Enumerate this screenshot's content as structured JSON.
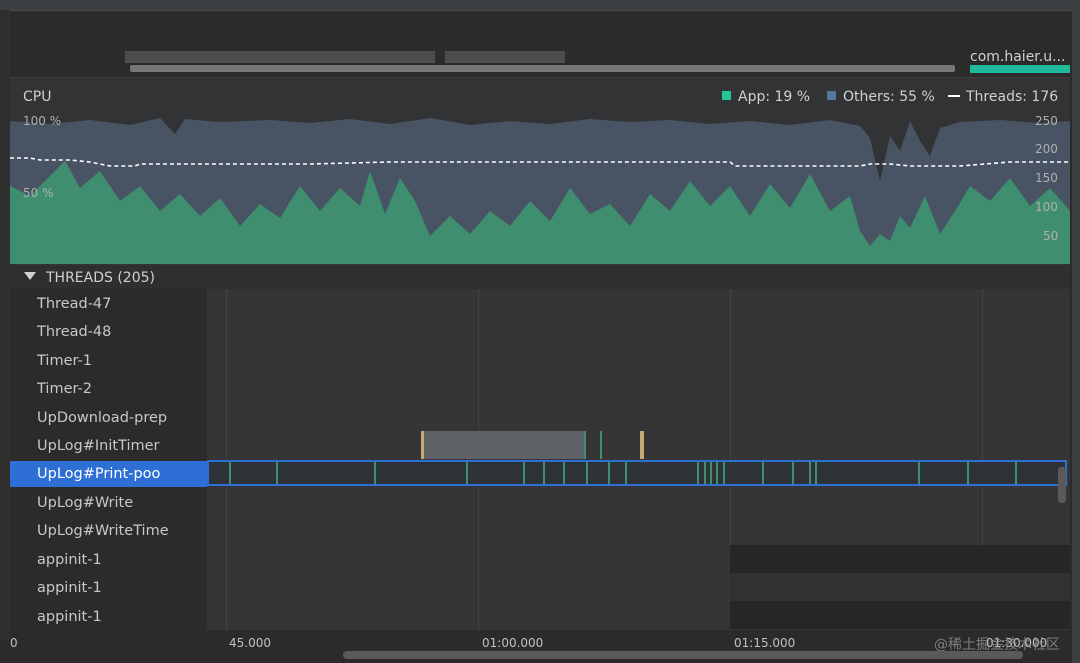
{
  "overview": {
    "process_label": "com.haier.u..."
  },
  "cpu": {
    "label": "CPU",
    "legend": {
      "app": "App: 19 %",
      "others": "Others: 55 %",
      "threads": "Threads: 176"
    },
    "left_axis": [
      "100 %",
      "50 %"
    ],
    "right_axis": [
      "250",
      "200",
      "150",
      "100",
      "50"
    ],
    "colors": {
      "app": "#3e8e6f",
      "others": "#4e5a6b",
      "threads": "#ffffff"
    }
  },
  "threads": {
    "header": "THREADS (205)",
    "items": [
      "Thread-47",
      "Thread-48",
      "Timer-1",
      "Timer-2",
      "UpDownload-prep",
      "UpLog#InitTimer",
      "UpLog#Print-poo",
      "UpLog#Write",
      "UpLog#WriteTime",
      "appinit-1",
      "appinit-1",
      "appinit-1"
    ],
    "selected_index": 6
  },
  "time_axis": {
    "ticks": [
      "0",
      "45.000",
      "01:00.000",
      "01:15.000",
      "01:30.000"
    ]
  },
  "watermark": "@稀土掘金技术社区"
}
